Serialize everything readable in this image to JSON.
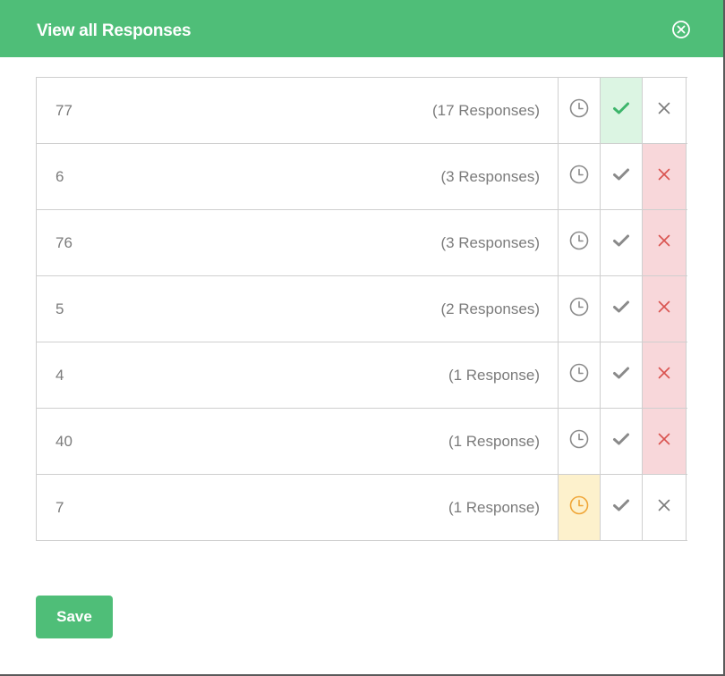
{
  "modal": {
    "title": "View all Responses",
    "close_icon": "circle-x-icon",
    "save_label": "Save"
  },
  "colors": {
    "accent": "#4fbe78",
    "accepted_bg": "#dcf5e3",
    "pending_bg": "#fdf1cc",
    "rejected_bg": "#f8d7da"
  },
  "rows": [
    {
      "label": "77",
      "count": "(17 Responses)",
      "state": "accepted"
    },
    {
      "label": "6",
      "count": "(3 Responses)",
      "state": "rejected"
    },
    {
      "label": "76",
      "count": "(3 Responses)",
      "state": "rejected"
    },
    {
      "label": "5",
      "count": "(2 Responses)",
      "state": "rejected"
    },
    {
      "label": "4",
      "count": "(1 Response)",
      "state": "rejected"
    },
    {
      "label": "40",
      "count": "(1 Response)",
      "state": "rejected"
    },
    {
      "label": "7",
      "count": "(1 Response)",
      "state": "pending"
    }
  ]
}
